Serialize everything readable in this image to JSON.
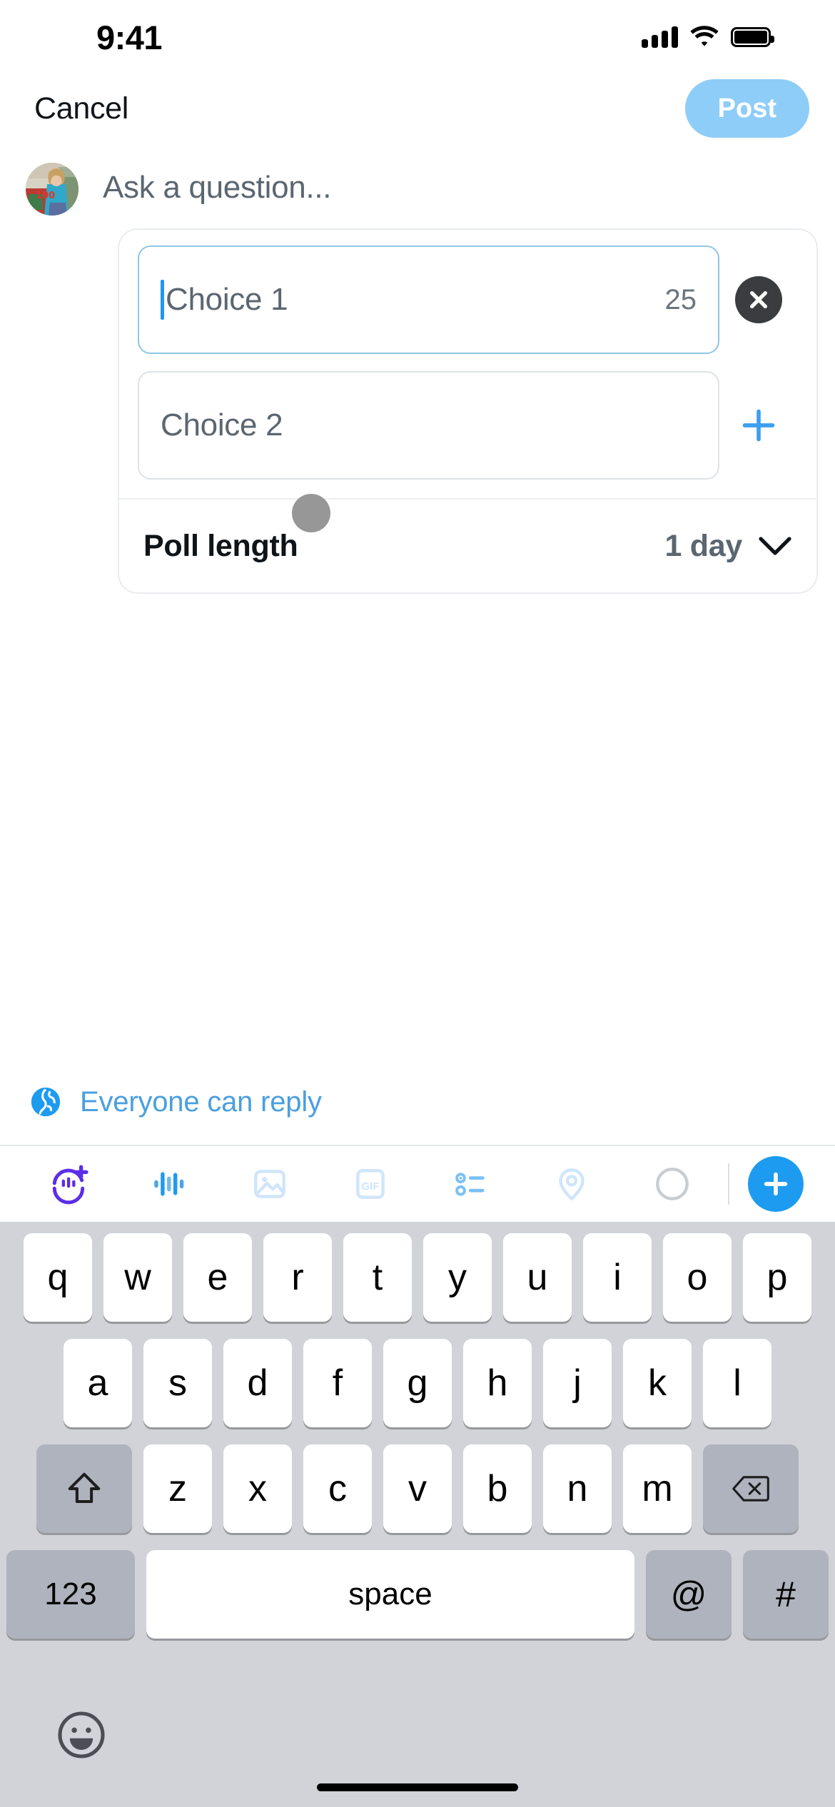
{
  "status_bar": {
    "time": "9:41",
    "signal_icon": "cellular-signal-icon",
    "wifi_icon": "wifi-icon",
    "battery_icon": "battery-icon"
  },
  "header": {
    "cancel_label": "Cancel",
    "post_label": "Post",
    "post_enabled": false,
    "post_bg_color": "#8ecdf7",
    "post_text_color": "#ffffff"
  },
  "composer": {
    "avatar_name": "user-avatar",
    "avatar_description": "profile photo of person in blue top in front of storefront with red 100 emoji sign",
    "placeholder": "Ask a question..."
  },
  "poll": {
    "choices": [
      {
        "placeholder": "Choice 1",
        "value": "",
        "char_count": "25",
        "focused": true,
        "action": "remove",
        "action_icon": "close-icon"
      },
      {
        "placeholder": "Choice 2",
        "value": "",
        "char_count": "",
        "focused": false,
        "action": "add",
        "action_icon": "plus-icon"
      }
    ],
    "length_label": "Poll length",
    "length_value": "1 day",
    "chevron_icon": "chevron-down-icon",
    "touch_indicator": "touch-dot"
  },
  "reply_setting": {
    "icon": "globe-icon",
    "label": "Everyone can reply",
    "color": "#4a9fe0"
  },
  "toolbar": {
    "items": [
      {
        "name": "voice-add-icon",
        "state": "active",
        "color": "#5b2ee8"
      },
      {
        "name": "audio-waveform-icon",
        "state": "active",
        "color": "#1d9bf0"
      },
      {
        "name": "image-icon",
        "state": "disabled",
        "color": "#cfe5fb"
      },
      {
        "name": "gif-icon",
        "state": "disabled",
        "color": "#cfe5fb"
      },
      {
        "name": "poll-icon",
        "state": "active",
        "color": "#7cc0f5"
      },
      {
        "name": "location-pin-icon",
        "state": "disabled",
        "color": "#cfe5fb"
      },
      {
        "name": "character-count-circle-icon",
        "state": "idle",
        "color": "#c9cdd1"
      }
    ],
    "plus_label": "+",
    "plus_icon": "plus-icon",
    "plus_color": "#1d9bf0"
  },
  "keyboard": {
    "row1": [
      "q",
      "w",
      "e",
      "r",
      "t",
      "y",
      "u",
      "i",
      "o",
      "p"
    ],
    "row2": [
      "a",
      "s",
      "d",
      "f",
      "g",
      "h",
      "j",
      "k",
      "l"
    ],
    "row3": [
      "z",
      "x",
      "c",
      "v",
      "b",
      "n",
      "m"
    ],
    "shift_icon": "shift-arrow-icon",
    "backspace_icon": "backspace-icon",
    "numbers_label": "123",
    "space_label": "space",
    "at_label": "@",
    "hash_label": "#",
    "emoji_icon": "emoji-smiley-icon",
    "bg_color": "#d1d3d9",
    "key_color": "#ffffff",
    "modifier_key_color": "#aeb3bd"
  }
}
